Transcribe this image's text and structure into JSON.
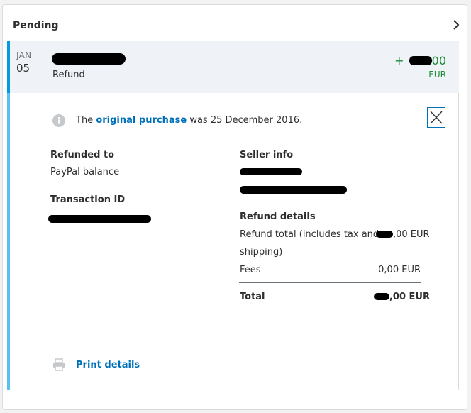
{
  "section": {
    "title": "Pending"
  },
  "transaction": {
    "month": "JAN",
    "day": "05",
    "type": "Refund",
    "amount_sign": "+",
    "amount_suffix": "00",
    "currency": "EUR"
  },
  "notice": {
    "text_before": "The",
    "link_text": "original purchase",
    "text_after": "was 25 December 2016."
  },
  "details": {
    "refunded_to_label": "Refunded to",
    "refunded_to_value": "PayPal balance",
    "transaction_id_label": "Transaction ID",
    "seller_info_label": "Seller info",
    "refund_details_label": "Refund details",
    "refund_total_label_1": "Refund total (includes tax and",
    "refund_total_label_2": "shipping)",
    "refund_total_suffix": ",00 EUR",
    "fees_label": "Fees",
    "fees_value": "0,00 EUR",
    "total_label": "Total",
    "total_suffix": ",00 EUR"
  },
  "actions": {
    "print_label": "Print details"
  },
  "colors": {
    "accent_blue": "#0070ba",
    "active_border": "#009cde",
    "positive_green": "#1e8b36",
    "redaction": "#000000"
  },
  "icons": {
    "chevron": "chevron-right-icon",
    "info": "info-icon",
    "close": "close-icon",
    "print": "printer-icon"
  }
}
